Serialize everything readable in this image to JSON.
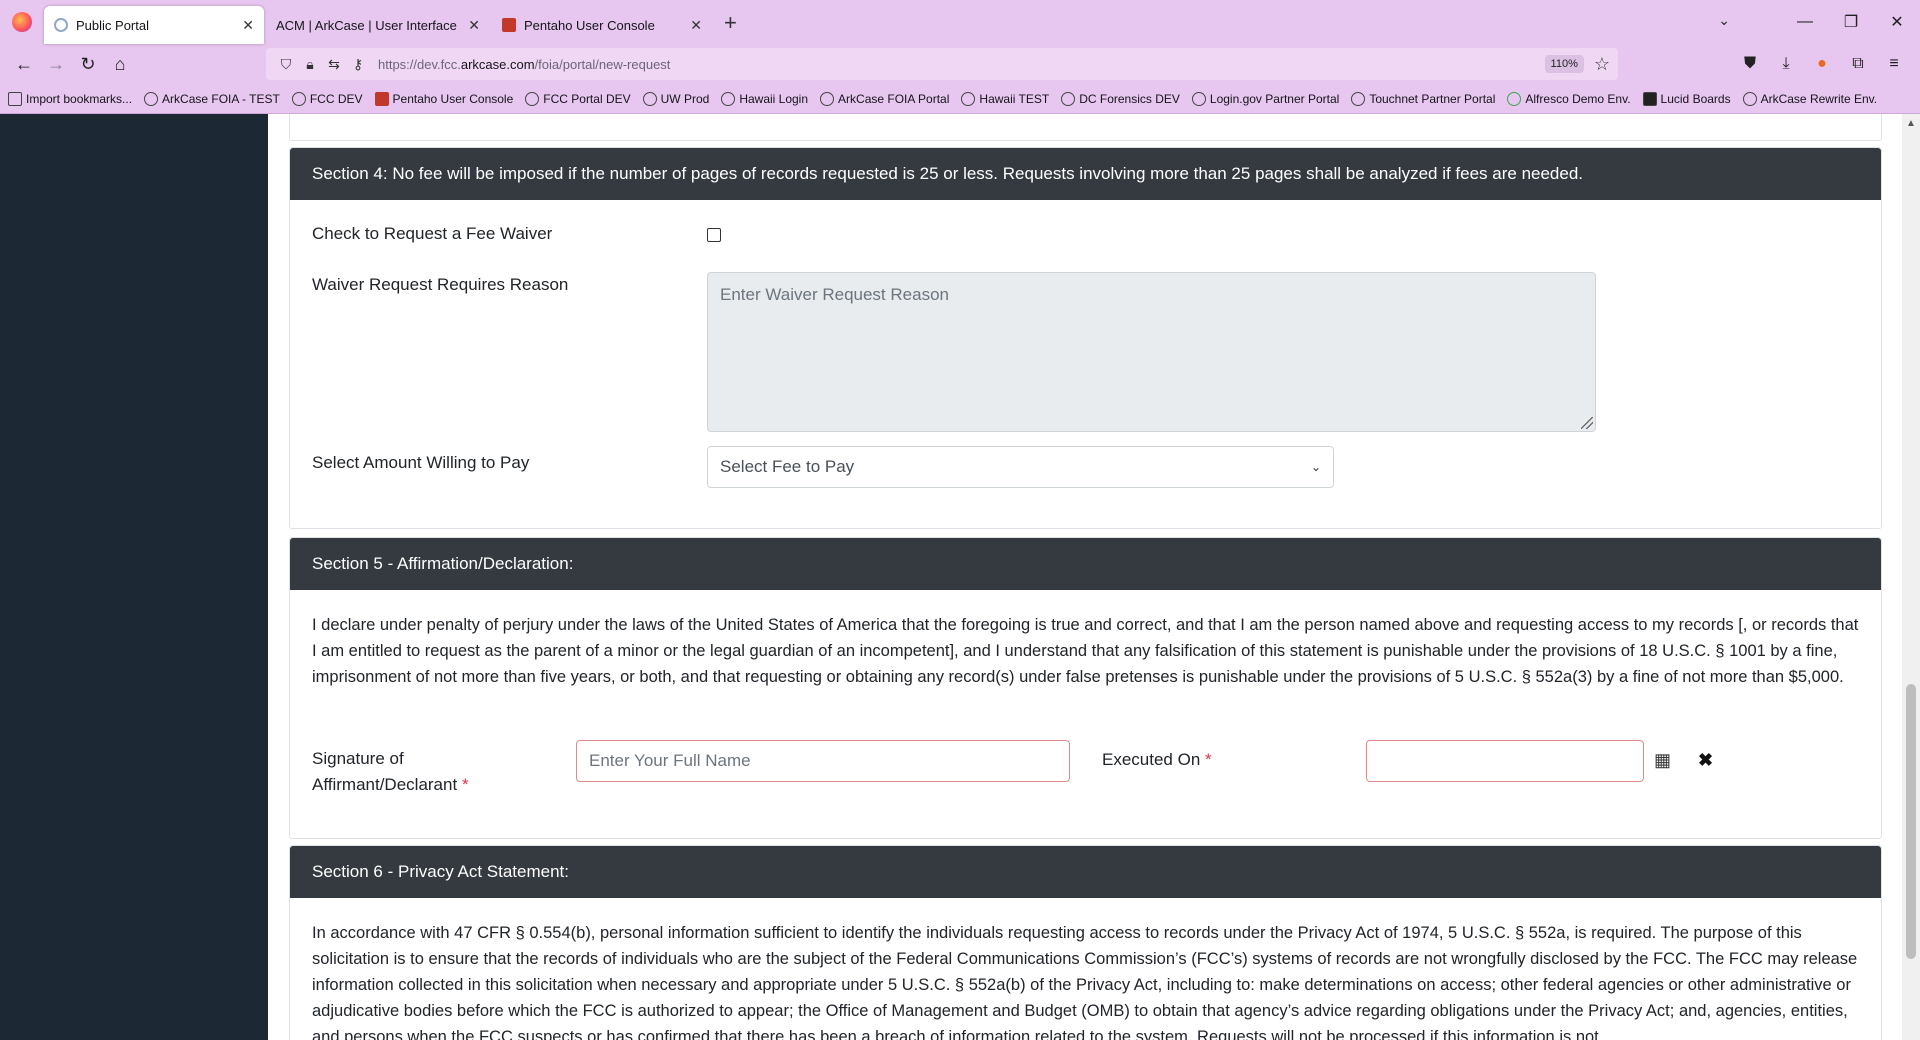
{
  "browser": {
    "tabs": [
      {
        "label": "Public Portal",
        "active": true
      },
      {
        "label": "ACM | ArkCase | User Interface",
        "active": false
      },
      {
        "label": "Pentaho User Console",
        "active": false
      }
    ],
    "url_prefix": "https://dev.fcc.",
    "url_domain": "arkcase.com",
    "url_path": "/foia/portal/new-request",
    "zoom": "110%",
    "bookmarks": [
      "Import bookmarks...",
      "ArkCase FOIA - TEST",
      "FCC DEV",
      "Pentaho User Console",
      "FCC Portal DEV",
      "UW Prod",
      "Hawaii Login",
      "ArkCase FOIA Portal",
      "Hawaii TEST",
      "DC Forensics DEV",
      "Login.gov Partner Portal",
      "Touchnet Partner Portal",
      "Alfresco Demo Env.",
      "Lucid Boards",
      "ArkCase Rewrite Env."
    ]
  },
  "section4": {
    "header": "Section 4: No fee will be imposed if the number of pages of records requested is 25 or less. Requests involving more than 25 pages shall be analyzed if fees are needed.",
    "fee_waiver_label": "Check to Request a Fee Waiver",
    "waiver_reason_label": "Waiver Request Requires Reason",
    "waiver_reason_placeholder": "Enter Waiver Request Reason",
    "amount_label": "Select Amount Willing to Pay",
    "amount_selected": "Select Fee to Pay"
  },
  "section5": {
    "header": "Section 5 - Affirmation/Declaration:",
    "declaration": "I declare under penalty of perjury under the laws of the United States of America that the foregoing is true and correct, and that I am the person named above and requesting access to my records [, or records that I am entitled to request as the parent of a minor or the legal guardian of an incompetent], and I understand that any falsification of this statement is punishable under the provisions of 18 U.S.C. § 1001 by a fine, imprisonment of not more than five years, or both, and that requesting or obtaining any record(s) under false pretenses is punishable under the provisions of 5 U.S.C. § 552a(3) by a fine of not more than $5,000.",
    "signature_label_line1": "Signature of",
    "signature_label_line2": "Affirmant/Declarant",
    "required_mark": "*",
    "signature_placeholder": "Enter Your Full Name",
    "executed_label": "Executed On",
    "executed_value": ""
  },
  "section6": {
    "header": "Section 6 - Privacy Act Statement:",
    "statement": "In accordance with 47 CFR § 0.554(b), personal information sufficient to identify the individuals requesting access to records under the Privacy Act of 1974, 5 U.S.C. § 552a, is required. The purpose of this solicitation is to ensure that the records of individuals who are the subject of the Federal Communications Commission’s (FCC’s) systems of records are not wrongfully disclosed by the FCC. The FCC may release information collected in this solicitation when necessary and appropriate under 5 U.S.C. § 552a(b) of the Privacy Act, including to: make determinations on access; other federal agencies or other administrative or adjudicative bodies before which the FCC is authorized to appear; the Office of Management and Budget (OMB) to obtain that agency’s advice regarding obligations under the Privacy Act; and, agencies, entities, and persons when the FCC suspects or has confirmed that there has been a breach of information related to the system. Requests will not be processed if this information is not"
  }
}
